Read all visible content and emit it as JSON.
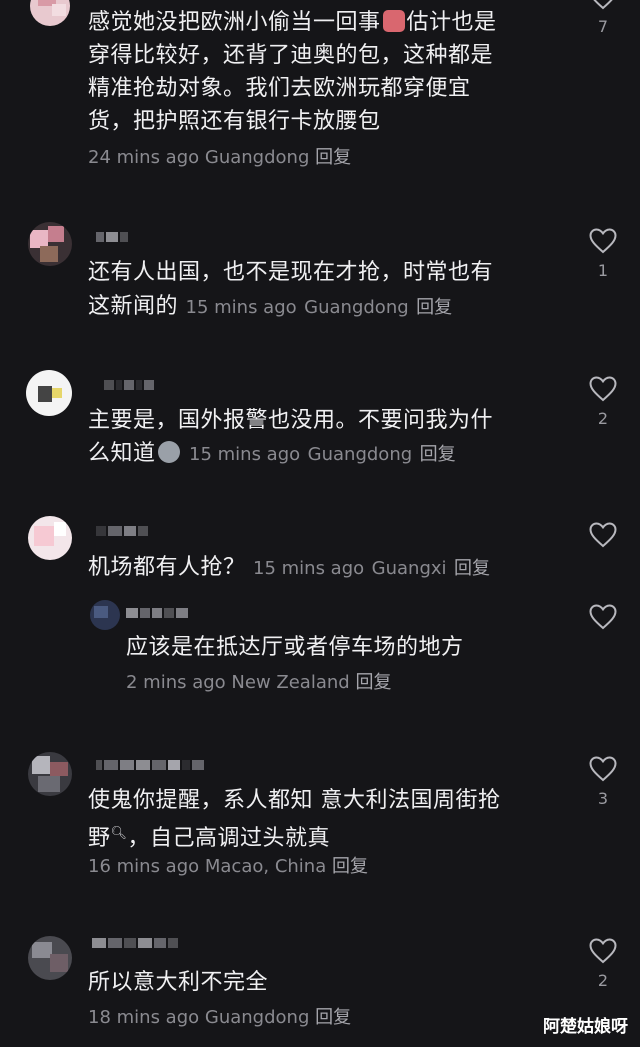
{
  "comments": [
    {
      "text_line1": "感觉她没把欧洲小偷当一回事",
      "text_line1b": "估计也是",
      "text_line2": "穿得比较好，还背了迪奥的包，这种都是",
      "text_line3": "精准抢劫对象。我们去欧洲玩都穿便宜",
      "text_line4": "货，把护照还有银行卡放腰包",
      "time": "24 mins ago",
      "location": "Guangdong",
      "reply": "回复",
      "likes": "7",
      "emoji_icon": "crying-face-icon"
    },
    {
      "text_line1": "还有人出国，也不是现在才抢，时常也有",
      "text_line2": "这新闻的",
      "time": "15 mins ago",
      "location": "Guangdong",
      "reply": "回复",
      "likes": "1"
    },
    {
      "text_line1": "主要是，国外报警也没用。不要问我为什",
      "text_line2": "么知道",
      "time": "15 mins ago",
      "location": "Guangdong",
      "reply": "回复",
      "likes": "2",
      "emoji_icon": "blob-face-icon"
    },
    {
      "text_line1": "机场都有人抢？",
      "time": "15 mins ago",
      "location": "Guangxi",
      "reply": "回复",
      "likes": ""
    },
    {
      "text_line1": "应该是在抵达厅或者停车场的地方",
      "time": "2 mins ago",
      "location": "New Zealand",
      "reply": "回复",
      "likes": ""
    },
    {
      "text_line1": "使鬼你提醒，系人都知 意大利法国周街抢",
      "text_line2": "野",
      "text_line2b": "，自己高调过头就真",
      "time": "16 mins ago",
      "location": "Macao, China",
      "reply": "回复",
      "likes": "3"
    },
    {
      "text_line1": "所以意大利不完全",
      "time": "18 mins ago",
      "location": "Guangdong",
      "reply": "回复",
      "likes": "2"
    }
  ],
  "watermark": "阿楚姑娘呀",
  "colors": {
    "background": "#151518",
    "text": "#f0f0f2",
    "meta": "#8a8a90"
  }
}
